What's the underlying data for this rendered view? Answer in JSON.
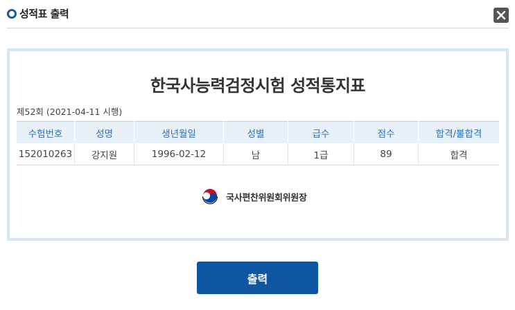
{
  "dialog": {
    "title": "성적표 출력",
    "close_icon": "close-icon"
  },
  "document": {
    "title": "한국사능력검정시험 성적통지표",
    "exam_info": "제52회 (2021-04-11 시행)",
    "table": {
      "headers": [
        "수험번호",
        "성명",
        "생년월일",
        "성별",
        "급수",
        "점수",
        "합격/불합격"
      ],
      "rows": [
        [
          "152010263",
          "강지원",
          "1996-02-12",
          "남",
          "1급",
          "89",
          "합격"
        ]
      ]
    },
    "issuer": "국사편찬위원회위원장",
    "emblem_icon": "taegeuk-emblem-icon"
  },
  "actions": {
    "print_label": "출력"
  },
  "colors": {
    "accent": "#0f56a2",
    "header_text": "#2f6fb5",
    "card_border": "#d8e6f3",
    "table_header_bg": "#e8f0f8"
  }
}
